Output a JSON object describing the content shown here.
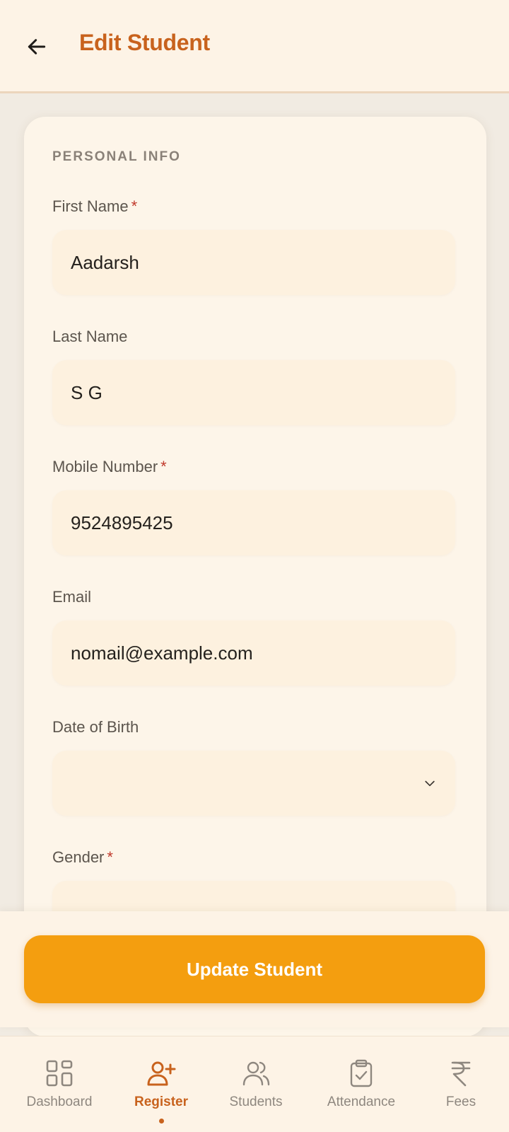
{
  "header": {
    "title": "Edit Student",
    "back_icon": "arrow-left-icon"
  },
  "form": {
    "section_title": "PERSONAL INFO",
    "fields": [
      {
        "label": "First Name",
        "required": true,
        "value": "Aadarsh"
      },
      {
        "label": "Last Name",
        "required": false,
        "value": "S G"
      },
      {
        "label": "Mobile Number",
        "required": true,
        "value": "9524895425"
      },
      {
        "label": "Email",
        "required": false,
        "value": "nomail@example.com"
      },
      {
        "label": "Date of Birth",
        "required": false,
        "value": ""
      },
      {
        "label": "Gender",
        "required": true,
        "value": ""
      }
    ],
    "required_mark": "*"
  },
  "action": {
    "update_label": "Update Student"
  },
  "nav": {
    "items": [
      {
        "label": "Dashboard",
        "icon": "dashboard-icon",
        "active": false
      },
      {
        "label": "Register",
        "icon": "user-plus-icon",
        "active": true
      },
      {
        "label": "Students",
        "icon": "users-icon",
        "active": false
      },
      {
        "label": "Attendance",
        "icon": "clipboard-check-icon",
        "active": false
      },
      {
        "label": "Fees",
        "icon": "rupee-icon",
        "active": false
      }
    ]
  },
  "colors": {
    "accent": "#c8621d",
    "button": "#f49e0f",
    "required": "#c0392b"
  }
}
